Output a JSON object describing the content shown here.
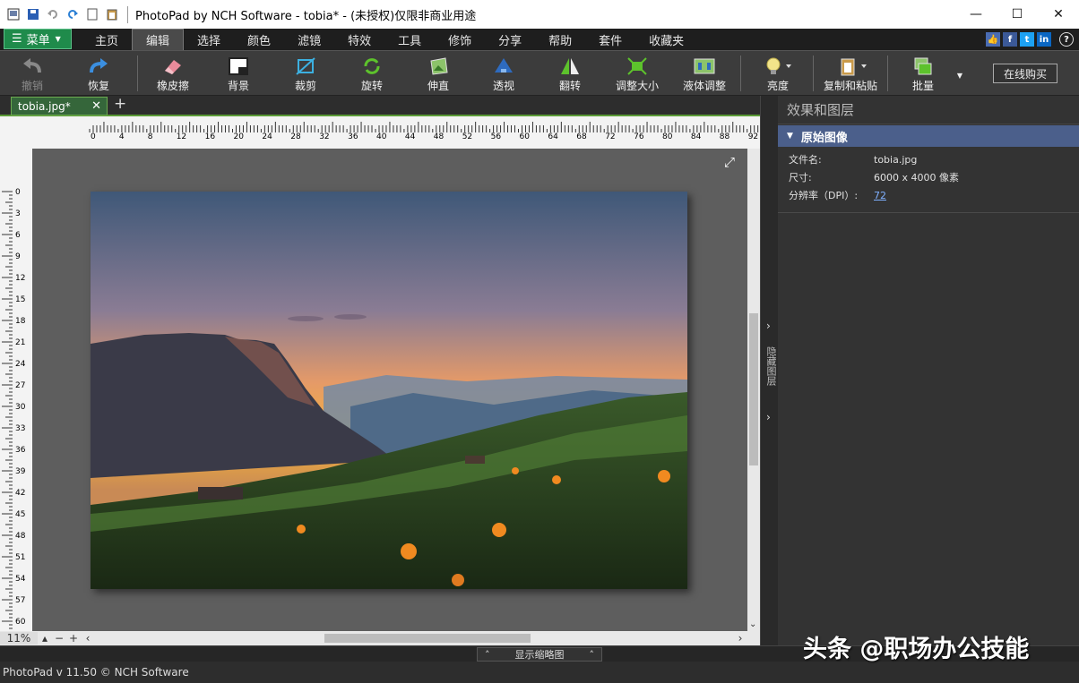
{
  "window": {
    "title": "PhotoPad by NCH Software - tobia* - (未授权)仅限非商业用途"
  },
  "menu": {
    "menu_button": "菜单",
    "tabs": [
      "主页",
      "编辑",
      "选择",
      "颜色",
      "滤镜",
      "特效",
      "工具",
      "修饰",
      "分享",
      "帮助",
      "套件",
      "收藏夹"
    ],
    "active_tab": "编辑"
  },
  "toolbar": {
    "undo": "撤销",
    "redo": "恢复",
    "eraser": "橡皮擦",
    "background": "背景",
    "crop": "裁剪",
    "rotate": "旋转",
    "straighten": "伸直",
    "perspective": "透视",
    "flip": "翻转",
    "resize": "调整大小",
    "liquid_resize": "液体调整",
    "brightness": "亮度",
    "copy_paste": "复制和粘贴",
    "batch": "批量",
    "buy_online": "在线购买"
  },
  "document": {
    "tab_name": "tobia.jpg*",
    "zoom": "11%"
  },
  "ruler": {
    "top": [
      "0",
      "4",
      "8",
      "12",
      "16",
      "20",
      "24",
      "28",
      "32",
      "36",
      "40",
      "44",
      "48",
      "52",
      "56",
      "60",
      "64",
      "68",
      "72",
      "76",
      "80",
      "84",
      "88",
      "92"
    ],
    "left": [
      "0",
      "3",
      "6",
      "9",
      "12",
      "15",
      "18",
      "21",
      "24",
      "27",
      "30",
      "33",
      "36",
      "39",
      "42",
      "45",
      "48",
      "51",
      "54",
      "57",
      "60"
    ]
  },
  "panel": {
    "title": "效果和图层",
    "section": "原始图像",
    "filename_label": "文件名:",
    "filename_value": "tobia.jpg",
    "size_label": "尺寸:",
    "size_value": "6000 x 4000 像素",
    "dpi_label": "分辨率（DPI）:",
    "dpi_value": "72",
    "hide_layers": "隐藏图层"
  },
  "thumbbar": {
    "label": "显示缩略图"
  },
  "status": {
    "text": "PhotoPad v 11.50 © NCH Software"
  },
  "watermark": {
    "text": "头条 @职场办公技能"
  },
  "colors": {
    "accent_green": "#1f8b4b",
    "panel_header": "#4b5f8b",
    "link": "#7fb0ff"
  }
}
